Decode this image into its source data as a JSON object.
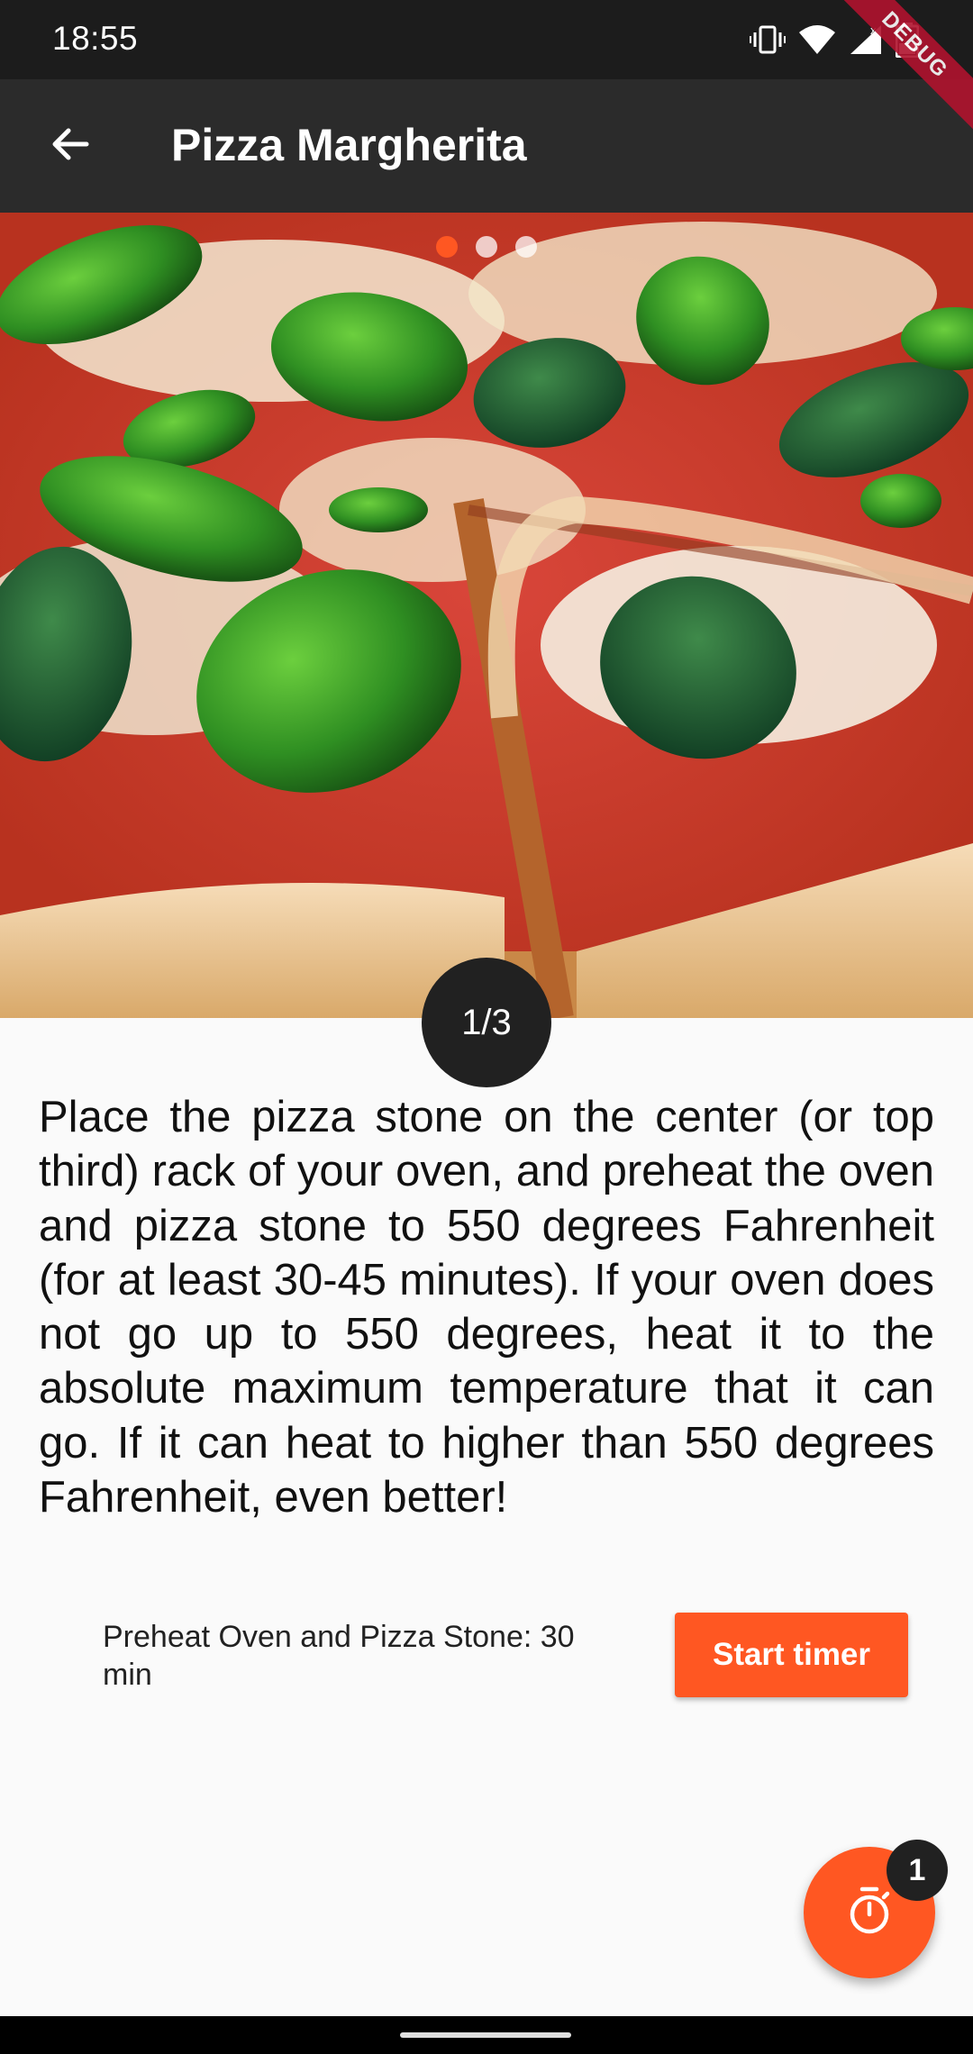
{
  "status_bar": {
    "time": "18:55",
    "battery_level": "32",
    "icons": [
      "vibrate-icon",
      "wifi-icon",
      "signal-icon",
      "battery-icon"
    ]
  },
  "debug_banner": "DEBUG",
  "app_bar": {
    "title": "Pizza Margherita",
    "back_icon": "arrow-back-icon"
  },
  "carousel": {
    "page_count": 3,
    "active_index": 0,
    "image": "pizza-margherita-photo"
  },
  "step": {
    "badge": "1/3",
    "instruction": "Place the pizza stone on the center (or top third) rack of your oven, and preheat the oven and pizza stone to 550 degrees Fahrenheit (for at least 30-45 minutes). If your oven does not go up to 550 degrees, heat it to the absolute maximum temperature that it can go. If it can heat to higher than 550 degrees Fahrenheit, even better!",
    "timer_label": "Preheat Oven and Pizza Stone: 30 min",
    "timer_button": "Start timer"
  },
  "fab": {
    "icon": "timer-icon",
    "badge_count": "1"
  },
  "colors": {
    "accent": "#ff5722",
    "app_bar": "#2b2b2b",
    "status_bar": "#1c1c1c",
    "badge": "#212121",
    "background": "#fafafa"
  }
}
